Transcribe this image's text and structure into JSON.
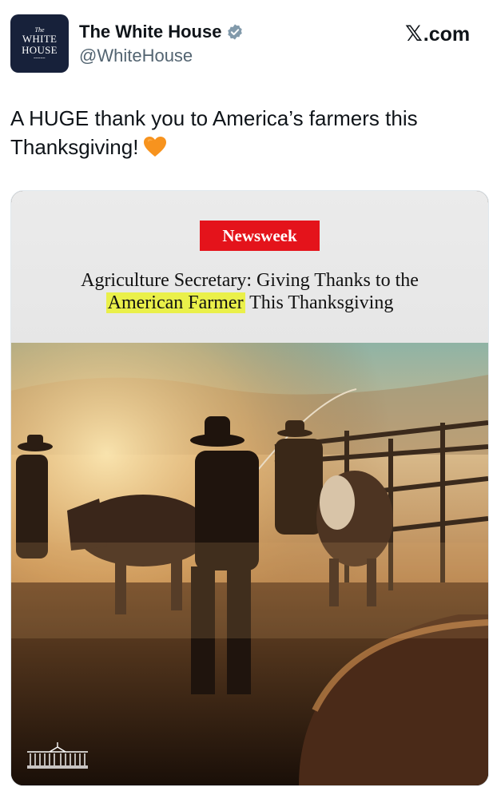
{
  "header": {
    "avatar_line1": "The",
    "avatar_line2": "WHITE",
    "avatar_line3": "HOUSE",
    "display_name": "The White House",
    "handle": "@WhiteHouse",
    "brand_x": "𝕏",
    "brand_suffix": ".com",
    "verified_color": "#829aab"
  },
  "tweet": {
    "text": "A HUGE thank you to America’s farmers this Thanksgiving!",
    "emoji": "orange-heart-icon"
  },
  "media": {
    "publication": "Newsweek",
    "headline_part1": "Agriculture Secretary: Giving Thanks to the",
    "headline_highlight": "American Farmer",
    "headline_part2": " This Thanksgiving",
    "logo_brand_color": "#e4131b",
    "highlight_color": "#eaf04a"
  }
}
